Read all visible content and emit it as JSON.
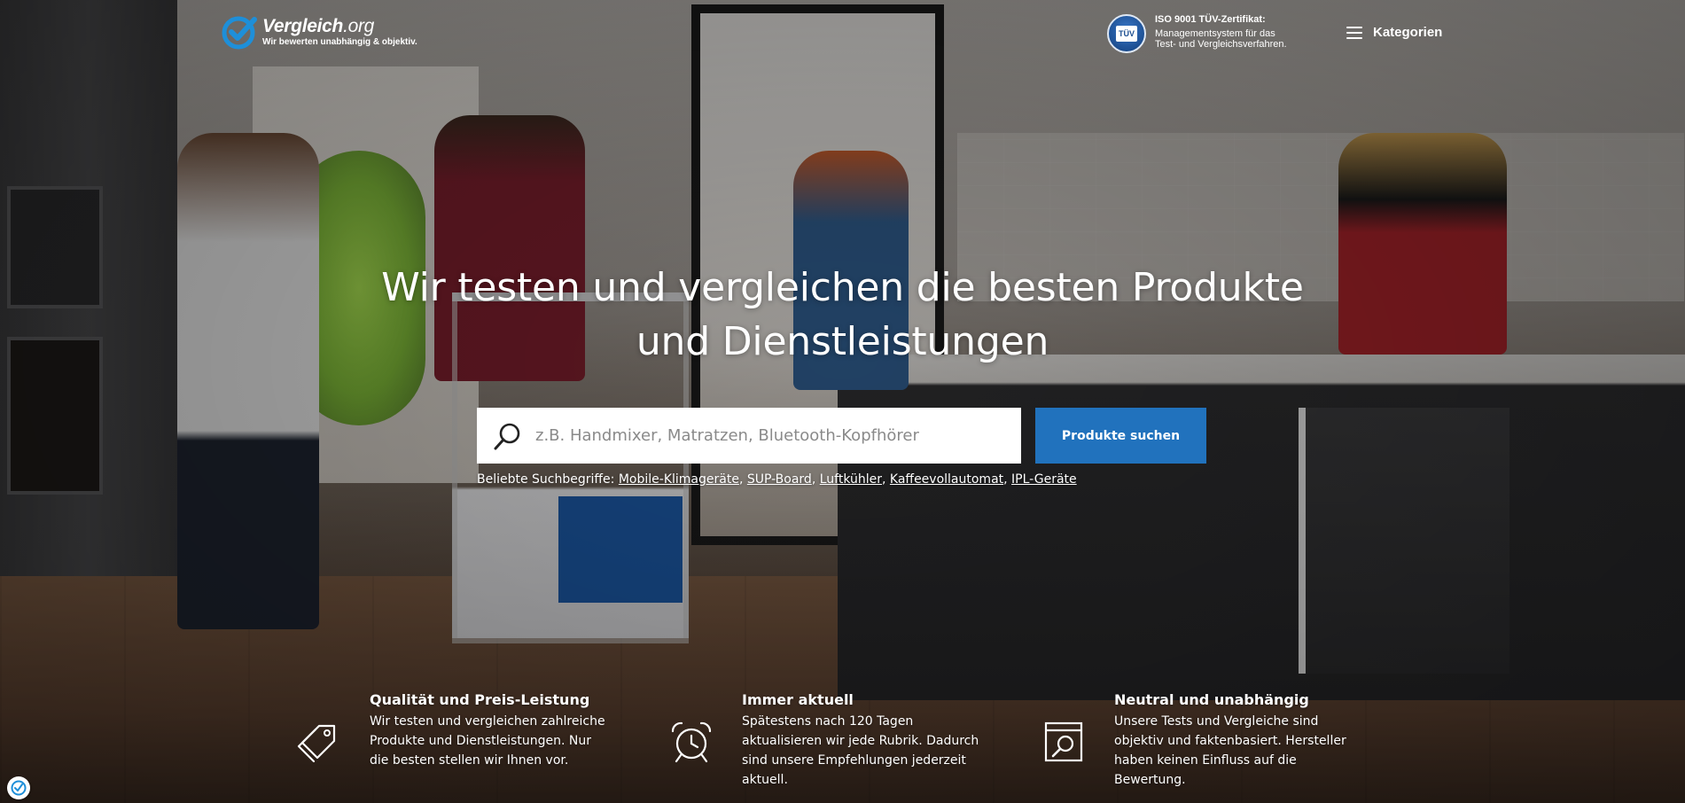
{
  "header": {
    "logo": {
      "brand": "Vergleich",
      "tld": ".org",
      "tagline": "Wir bewerten unabhängig & objektiv."
    },
    "certificate": {
      "badge_text": "TÜV",
      "title": "ISO 9001 TÜV-Zertifikat:",
      "line1": "Managementsystem für das",
      "line2": "Test- und Vergleichsverfahren."
    },
    "menu": {
      "label": "Kategorien"
    }
  },
  "hero": {
    "headline_line1": "Wir testen und vergleichen die besten Produkte",
    "headline_line2": "und Dienstleistungen"
  },
  "search": {
    "placeholder": "z.B. Handmixer, Matratzen, Bluetooth-Kopfhörer",
    "value": "",
    "button_label": "Produkte suchen",
    "popular_prefix": "Beliebte Suchbegriffe:",
    "popular_terms": [
      "Mobile-Klimageräte",
      "SUP-Board",
      "Luftkühler",
      "Kaffeevollautomat",
      "IPL-Geräte"
    ]
  },
  "features": [
    {
      "title": "Qualität und Preis-Leistung",
      "lines": [
        "Wir testen und vergleichen zahlreiche",
        "Produkte und Dienstleistungen. Nur",
        "die besten stellen wir Ihnen vor."
      ],
      "icon": "price-tag-icon"
    },
    {
      "title": "Immer aktuell",
      "lines": [
        "Spätestens nach 120 Tagen",
        "aktualisieren wir jede Rubrik. Dadurch",
        "sind unsere Empfehlungen jederzeit",
        "aktuell."
      ],
      "icon": "alarm-clock-icon"
    },
    {
      "title": "Neutral und unabhängig",
      "lines": [
        "Unsere Tests und Vergleiche sind",
        "objektiv und faktenbasiert. Hersteller",
        "haben keinen Einfluss auf die",
        "Bewertung."
      ],
      "icon": "magnifier-document-icon"
    }
  ],
  "colors": {
    "accent": "#2172bd",
    "logo_blue": "#1e8fd9",
    "text_on_hero": "#ffffff"
  }
}
